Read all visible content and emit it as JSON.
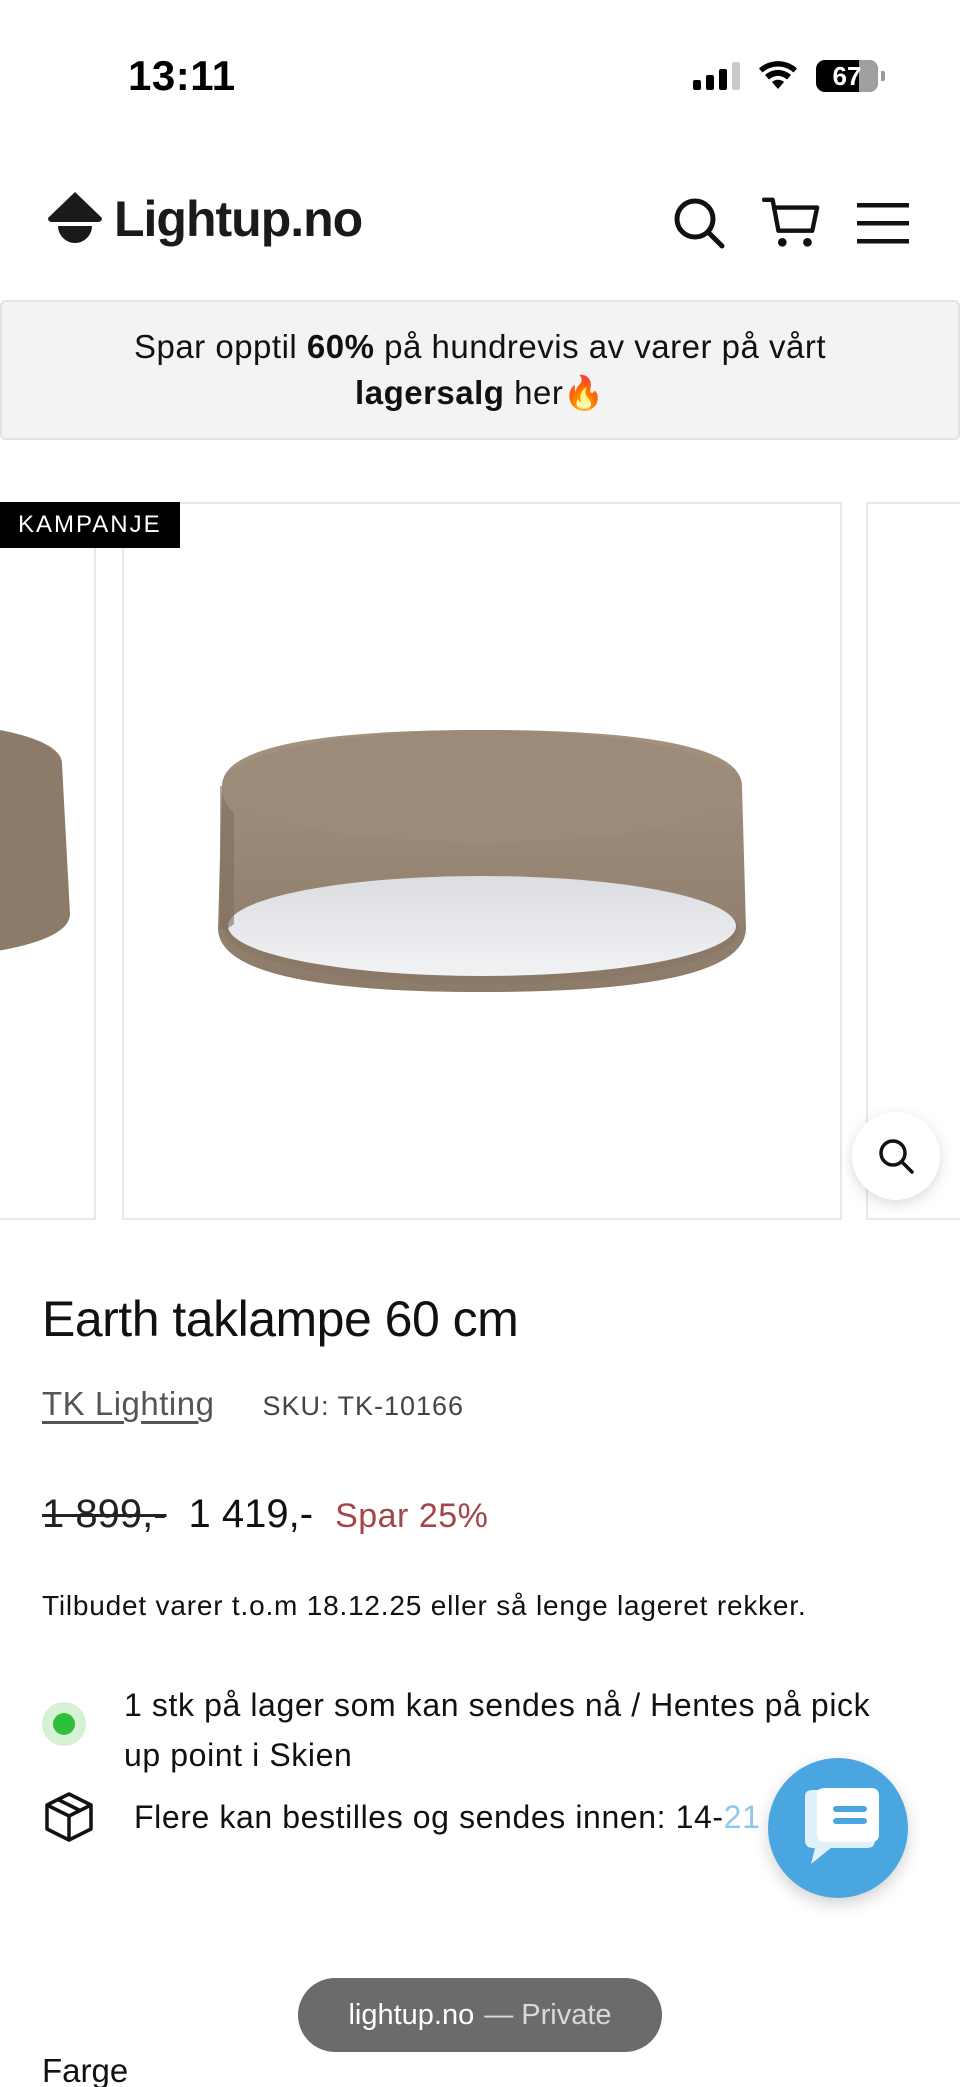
{
  "status_bar": {
    "time": "13:11",
    "battery": "67",
    "icons": [
      "signal-icon",
      "wifi-icon",
      "battery-icon"
    ]
  },
  "header": {
    "logo_text": "Lightup.no",
    "icons": [
      "search-icon",
      "cart-icon",
      "menu-icon"
    ]
  },
  "promo": {
    "line1_pre": "Spar opptil ",
    "line1_bold": "60%",
    "line1_post": " på hundrevis av varer på vårt",
    "line2_bold": "lagersalg",
    "line2_post": " her",
    "emoji": "🔥"
  },
  "gallery": {
    "badge": "KAMPANJE",
    "zoom_icon": "zoom-icon"
  },
  "product": {
    "title": "Earth taklampe 60 cm",
    "brand": "TK Lighting",
    "sku": "SKU: TK-10166",
    "price_old": "1 899,-",
    "price_new": "1 419,-",
    "save": "Spar 25%",
    "offer_note": "Tilbudet varer t.o.m 18.12.25 eller så lenge lageret rekker.",
    "stock_text": "1 stk på lager som kan sendes nå / Hentes på pick up point i Skien",
    "ship_text": "Flere kan bestilles og sendes innen: 14-",
    "ship_text_faded": "21 dager",
    "option_label": "Farge"
  },
  "browser": {
    "domain": "lightup.no",
    "mode": "— Private"
  },
  "colors": {
    "save_red": "#a3464a",
    "stock_green": "#2fbf3a",
    "chat_blue": "#4aa6e0",
    "banner_bg": "#f3f3f3"
  }
}
